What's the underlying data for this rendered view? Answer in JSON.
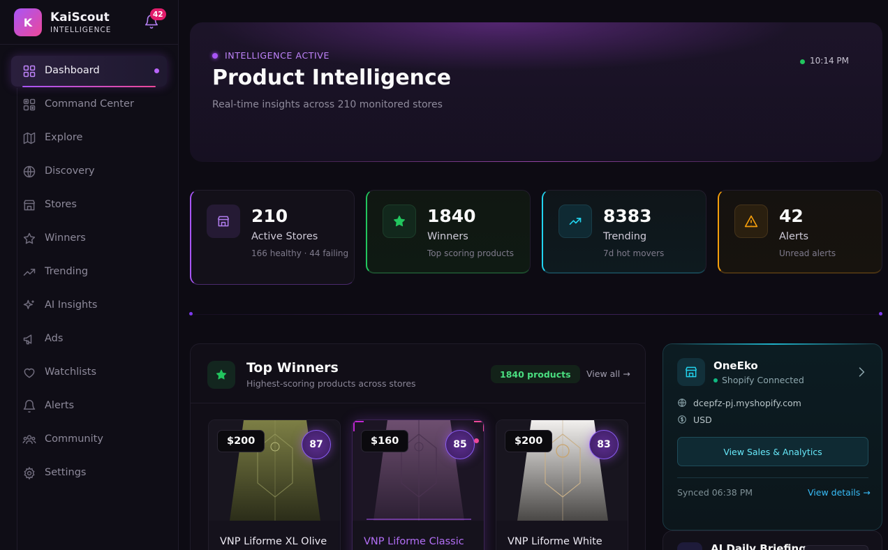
{
  "brand": {
    "initial": "K",
    "name": "KaiScout",
    "subtitle": "INTELLIGENCE",
    "notification_count": "42"
  },
  "sidebar": {
    "items": [
      {
        "label": "Dashboard",
        "icon": "grid-icon",
        "active": true
      },
      {
        "label": "Command Center",
        "icon": "command-icon"
      },
      {
        "label": "Explore",
        "icon": "map-icon"
      },
      {
        "label": "Discovery",
        "icon": "globe-icon"
      },
      {
        "label": "Stores",
        "icon": "store-icon"
      },
      {
        "label": "Winners",
        "icon": "star-icon"
      },
      {
        "label": "Trending",
        "icon": "trending-up-icon"
      },
      {
        "label": "AI Insights",
        "icon": "sparkles-icon"
      },
      {
        "label": "Ads",
        "icon": "megaphone-icon"
      },
      {
        "label": "Watchlists",
        "icon": "heart-icon"
      },
      {
        "label": "Alerts",
        "icon": "bell-icon"
      },
      {
        "label": "Community",
        "icon": "users-icon"
      },
      {
        "label": "Settings",
        "icon": "gear-icon"
      }
    ]
  },
  "hero": {
    "kicker": "INTELLIGENCE ACTIVE",
    "title": "Product Intelligence",
    "subtitle": "Real-time insights across 210 monitored stores",
    "time": "10:14 PM"
  },
  "stats": [
    {
      "value": "210",
      "label": "Active Stores",
      "sub": "166 healthy · 44 failing",
      "color": "#a855f7",
      "icon": "store-icon"
    },
    {
      "value": "1840",
      "label": "Winners",
      "sub": "Top scoring products",
      "color": "#22c55e",
      "icon": "star-icon"
    },
    {
      "value": "8383",
      "label": "Trending",
      "sub": "7d hot movers",
      "color": "#22d3ee",
      "icon": "trending-up-icon"
    },
    {
      "value": "42",
      "label": "Alerts",
      "sub": "Unread alerts",
      "color": "#f59e0b",
      "icon": "warning-icon"
    }
  ],
  "winners": {
    "title": "Top Winners",
    "subtitle": "Highest-scoring products across stores",
    "count_badge": "1840 products",
    "view_all": "View all →",
    "products": [
      {
        "price": "$200",
        "score": "87",
        "name": "VNP Liforme XL Olive"
      },
      {
        "price": "$160",
        "score": "85",
        "name": "VNP Liforme Classic"
      },
      {
        "price": "$200",
        "score": "83",
        "name": "VNP Liforme White"
      }
    ]
  },
  "store": {
    "name": "OneEko",
    "status": "Shopify Connected",
    "domain": "dcepfz-pj.myshopify.com",
    "currency": "USD",
    "button": "View Sales & Analytics",
    "synced": "Synced 06:38 PM",
    "details": "View details →"
  },
  "briefing": {
    "title": "AI Daily Briefing"
  },
  "colors": {
    "accent": "#a855f7",
    "pink": "#ec4899",
    "cyan": "#22d3ee",
    "green": "#22c55e",
    "amber": "#f59e0b"
  }
}
